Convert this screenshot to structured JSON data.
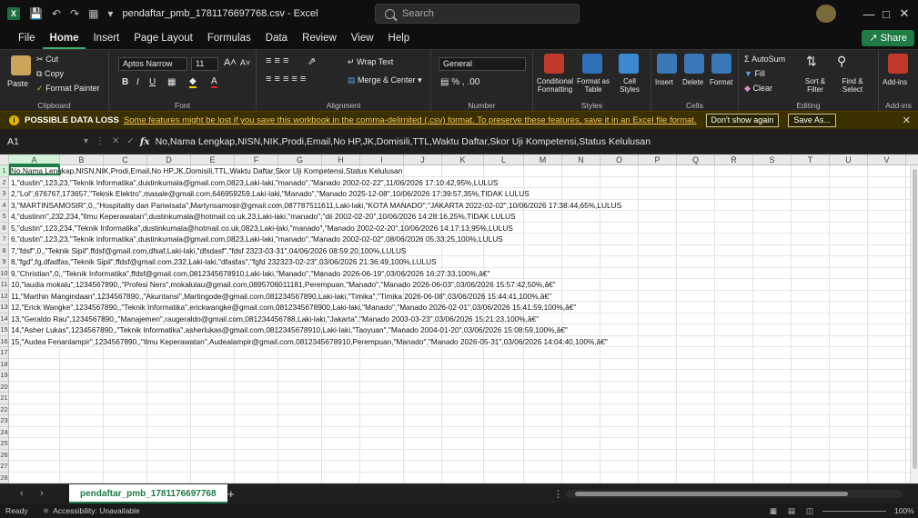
{
  "titlebar": {
    "filename": "pendaftar_pmb_1781176697768.csv",
    "app": "Excel",
    "separator": "-",
    "search_placeholder": "Search"
  },
  "menu": {
    "tabs": [
      "File",
      "Home",
      "Insert",
      "Page Layout",
      "Formulas",
      "Data",
      "Review",
      "View",
      "Help"
    ],
    "active": "Home",
    "share_label": "Share"
  },
  "ribbon": {
    "clipboard": {
      "label": "Clipboard",
      "paste": "Paste",
      "cut": "Cut",
      "copy": "Copy",
      "format_painter": "Format Painter"
    },
    "font": {
      "label": "Font",
      "name": "Aptos Narrow",
      "size": "11"
    },
    "alignment": {
      "label": "Alignment",
      "wrap": "Wrap Text",
      "merge": "Merge & Center"
    },
    "number": {
      "label": "Number",
      "format": "General"
    },
    "styles": {
      "label": "Styles",
      "conditional": "Conditional Formatting",
      "format_table": "Format as Table",
      "cell_styles": "Cell Styles"
    },
    "cells": {
      "label": "Cells",
      "insert": "Insert",
      "delete": "Delete",
      "format": "Format"
    },
    "editing": {
      "label": "Editing",
      "autosum": "AutoSum",
      "fill": "Fill",
      "clear": "Clear",
      "sort": "Sort & Filter",
      "find": "Find & Select"
    },
    "addins": {
      "label": "Add-ins",
      "button": "Add-ins"
    }
  },
  "notice": {
    "title": "POSSIBLE DATA LOSS",
    "text": "Some features might be lost if you save this workbook in the comma-delimited (.csv) format. To preserve these features, save it in an Excel file format.",
    "dont_show": "Don't show again",
    "save_as": "Save As..."
  },
  "formula": {
    "cell_ref": "A1",
    "content": "No,Nama Lengkap,NISN,NIK,Prodi,Email,No HP,JK,Domisili,TTL,Waktu Daftar,Skor Uji Kompetensi,Status Kelulusan"
  },
  "grid": {
    "columns": [
      "A",
      "B",
      "C",
      "D",
      "E",
      "F",
      "G",
      "H",
      "I",
      "J",
      "K",
      "L",
      "M",
      "N",
      "O",
      "P",
      "Q",
      "R",
      "S",
      "T",
      "U",
      "V",
      "W"
    ],
    "rows": [
      "No,Nama Lengkap,NISN,NIK,Prodi,Email,No HP,JK,Domisili,TTL,Waktu Daftar,Skor Uji Kompetensi,Status Kelulusan",
      "1,\"dustin\",123,23,\"Teknik Informatika\",dustinkumala@gmail.com,0823,Laki-laki,\"manado\",\"Manado 2002-02-22\",11/06/2026 17:10:42,95%,LULUS",
      "2,\"Lol\",676767,173657,\"Teknik Elektro\",masale@gmail.com,646959259,Laki-laki,\"Manado\",\"Manado 2025-12-08\",10/06/2026 17:39:57,35%,TIDAK LULUS",
      "3,\"MARTINSAMOSIR\",0,,\"Hospitality dan Pariwisata\",Martynsamosir@gmail.com,087787511611,Laki-laki,\"KOTA MANADO\",\"JAKARTA 2022-02-02\",10/06/2026 17:38:44,65%,LULUS",
      "4,\"dustinm\",232,234,\"Ilmu Keperawatan\",dustinkumala@hotmail.co.uk,23,Laki-laki,\"manado\",\"dii 2002-02-20\",10/06/2026 14:28:16,25%,TIDAK LULUS",
      "5,\"dustin\",123,234,\"Teknik Informatika\",dustinkumala@hotmail.co.uk,0823,Laki-laki,\"manado\",\"Manado 2002-02-20\",10/06/2026 14:17:13,95%,LULUS",
      "6,\"dustin\",123,23,\"Teknik Informatika\",dustinkumala@gmail.com,0823,Laki-laki,\"manado\",\"Manado 2002-02-02\",08/06/2026 05:33:25,100%,LULUS",
      "7,\"fdsf\",0,,\"Teknik Sipil\",ffdsf@gmail.com,dfsaf,Laki-laki,\"dfsdasf\",\"fdsf 2323-03-31\",04/06/2026 08:59:20,100%,LULUS",
      "8,\"fgd\",fg,dfadfas,\"Teknik Sipil\",ffdsf@gmail.com,232,Laki-laki,\"dfasfas\",\"fgfd 232323-02-23\",03/06/2026 21:36:49,100%,LULUS",
      "9,\"Christian\",0,,\"Teknik Informatika\",ffdsf@gmail.com,0812345678910,Laki-laki,\"Manado\",\"Manado 2026-06-19\",03/06/2026 16:27:33,100%,â€\"",
      "10,\"laudia mokalu\",1234567890,,\"Profesi Ners\",mokalulau@gmail.com,0895706011181,Perempuan,\"Manado\",\"Manado 2026-06-03\",03/06/2026 15:57:42,50%,â€\"",
      "11,\"Marthin Mangindaan\",1234567890,,\"Akuntansi\",Martingode@gmail.com,081234567890,Laki-laki,\"Timika\",\"Timika 2026-06-08\",03/06/2026 15:44:41,100%,â€\"",
      "12,\"Erick Wangke\",1234567890,,\"Teknik Informatika\",erickwangke@gmail.com,0812345678900,Laki-laki,\"Manado\",\"Manado 2026-02-01\",03/06/2026 15:41:59,100%,â€\"",
      "13,\"Geraldo Rau\",1234567890,,\"Manajemen\",raugeraldo@gmail.com,081234456788,Laki-laki,\"Jakarta\",\"Manado 2003-03-23\",03/06/2026 15:21:23,100%,â€\"",
      "14,\"Asher Lukas\",1234567890,,\"Teknik Informatika\",asherlukas@gmail.com,0812345678910,Laki-laki,\"Taoyuan\",\"Manado 2004-01-20\",03/06/2026 15:08:59,100%,â€\"",
      "15,\"Audea Fenanlampir\",1234567890,,\"Ilmu Keperawatan\",Audealampir@gmail.com,0812345678910,Perempuan,\"Manado\",\"Manado 2026-05-31\",03/06/2026 14:04:40,100%,â€\""
    ],
    "row_count": 28
  },
  "sheet": {
    "tab_name": "pendaftar_pmb_1781176697768"
  },
  "status": {
    "ready": "Ready",
    "accessibility": "Accessibility: Unavailable",
    "zoom": "100%"
  },
  "colors": {
    "excel_green": "#1e7b45",
    "notice_bg": "#3a3000",
    "link_yellow": "#f7c35b"
  },
  "icons": [
    "excel-icon",
    "save-icon",
    "undo-icon",
    "redo-icon",
    "search-icon",
    "paste-icon",
    "cut-icon",
    "copy-icon",
    "format-painter-icon",
    "bold-icon",
    "italic-icon",
    "underline-icon",
    "warning-icon",
    "close-icon",
    "fx-icon"
  ]
}
